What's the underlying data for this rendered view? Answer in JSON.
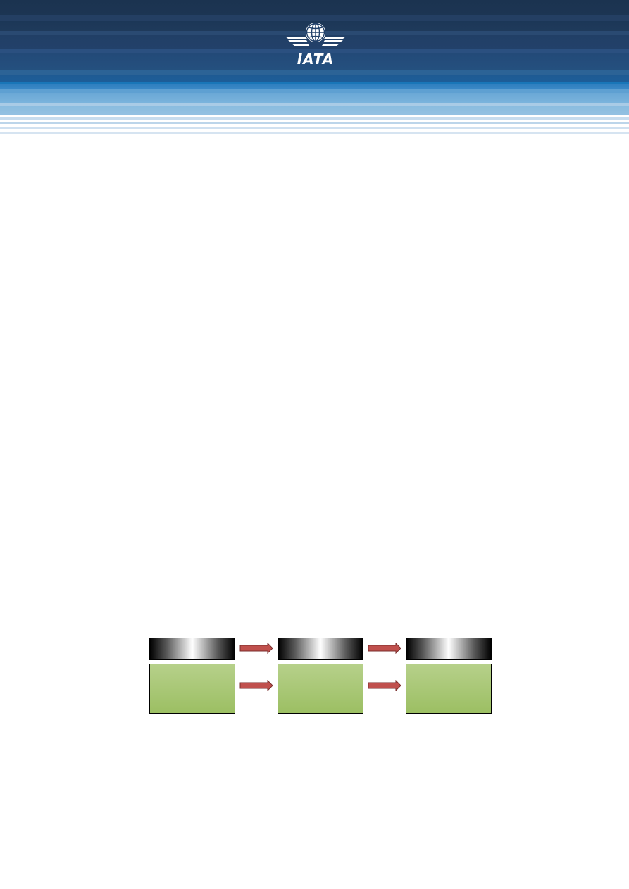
{
  "header": {
    "logo_text": "IATA",
    "colors": {
      "dark_navy": "#1b3350",
      "mid_blue": "#2b5080",
      "light_blue": "#93c1e2"
    }
  },
  "diagram": {
    "stages": [
      {
        "name": "",
        "content": ""
      },
      {
        "name": "",
        "content": ""
      },
      {
        "name": "",
        "content": ""
      }
    ],
    "colors": {
      "stage_body": "#9cbf63",
      "arrow_fill": "#c0504d",
      "arrow_stroke": "#7a2e2c"
    }
  },
  "footnotes": {
    "link_color": "#1f7a74"
  }
}
